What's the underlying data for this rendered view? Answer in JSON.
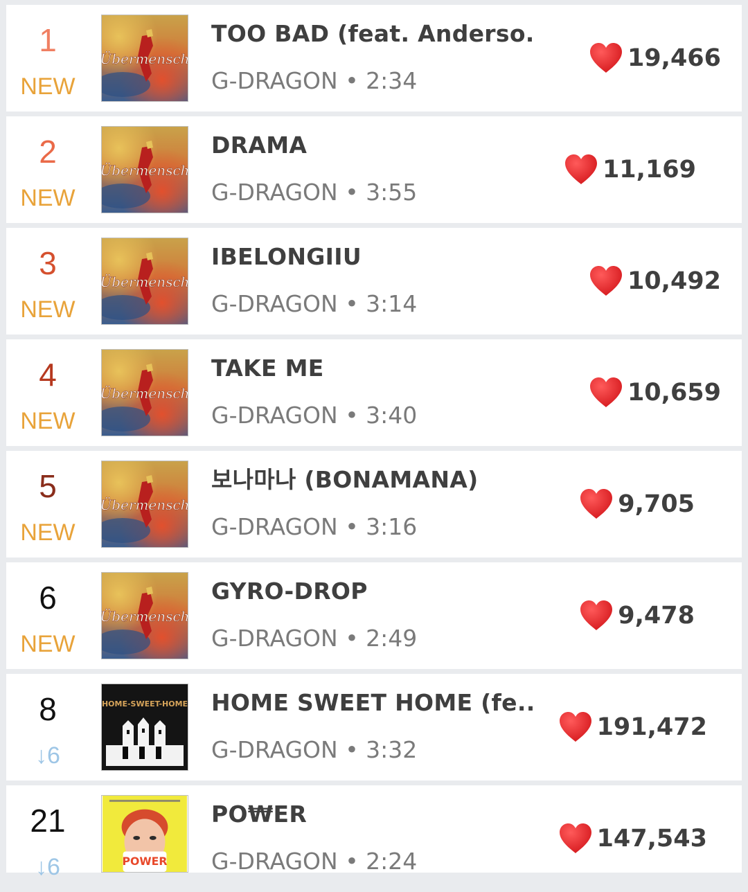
{
  "colors": {
    "rank_1": "#f07f62",
    "rank_2": "#ea6a48",
    "rank_3": "#d5502e",
    "rank_4": "#b6391f",
    "rank_5": "#8a2d1b",
    "rank_default": "#111111",
    "new_badge": "#e8a33a",
    "down_arrow": "#9ec6e6",
    "heart": "#d81e22"
  },
  "icons": {
    "like": "heart-icon",
    "down": "arrow-down"
  },
  "songs": [
    {
      "rank": "1",
      "change": "NEW",
      "change_type": "new",
      "cover": "ubermensch",
      "cover_text": "Übermensch",
      "title": "TOO BAD (feat. Anderso...",
      "meta": "G-DRAGON • 2:34",
      "likes": "19,466"
    },
    {
      "rank": "2",
      "change": "NEW",
      "change_type": "new",
      "cover": "ubermensch",
      "cover_text": "Übermensch",
      "title": "DRAMA",
      "meta": "G-DRAGON • 3:55",
      "likes": "11,169"
    },
    {
      "rank": "3",
      "change": "NEW",
      "change_type": "new",
      "cover": "ubermensch",
      "cover_text": "Übermensch",
      "title": "IBELONGIIU",
      "meta": "G-DRAGON • 3:14",
      "likes": "10,492"
    },
    {
      "rank": "4",
      "change": "NEW",
      "change_type": "new",
      "cover": "ubermensch",
      "cover_text": "Übermensch",
      "title": "TAKE ME",
      "meta": "G-DRAGON • 3:40",
      "likes": "10,659"
    },
    {
      "rank": "5",
      "change": "NEW",
      "change_type": "new",
      "cover": "ubermensch",
      "cover_text": "Übermensch",
      "title": "보나마나 (BONAMANA)",
      "meta": "G-DRAGON • 3:16",
      "likes": "9,705"
    },
    {
      "rank": "6",
      "change": "NEW",
      "change_type": "new",
      "cover": "ubermensch",
      "cover_text": "Übermensch",
      "title": "GYRO-DROP",
      "meta": "G-DRAGON • 2:49",
      "likes": "9,478"
    },
    {
      "rank": "8",
      "change": "↓6",
      "change_type": "down",
      "cover": "homesweethome",
      "cover_text": "HOME-SWEET-HOME",
      "title": "HOME SWEET HOME (fe...",
      "meta": "G-DRAGON • 3:32",
      "likes": "191,472"
    },
    {
      "rank": "21",
      "change": "↓6",
      "change_type": "down",
      "cover": "power",
      "cover_text": "POWER",
      "title": "PO₩ER",
      "meta": "G-DRAGON • 2:24",
      "likes": "147,543"
    }
  ]
}
